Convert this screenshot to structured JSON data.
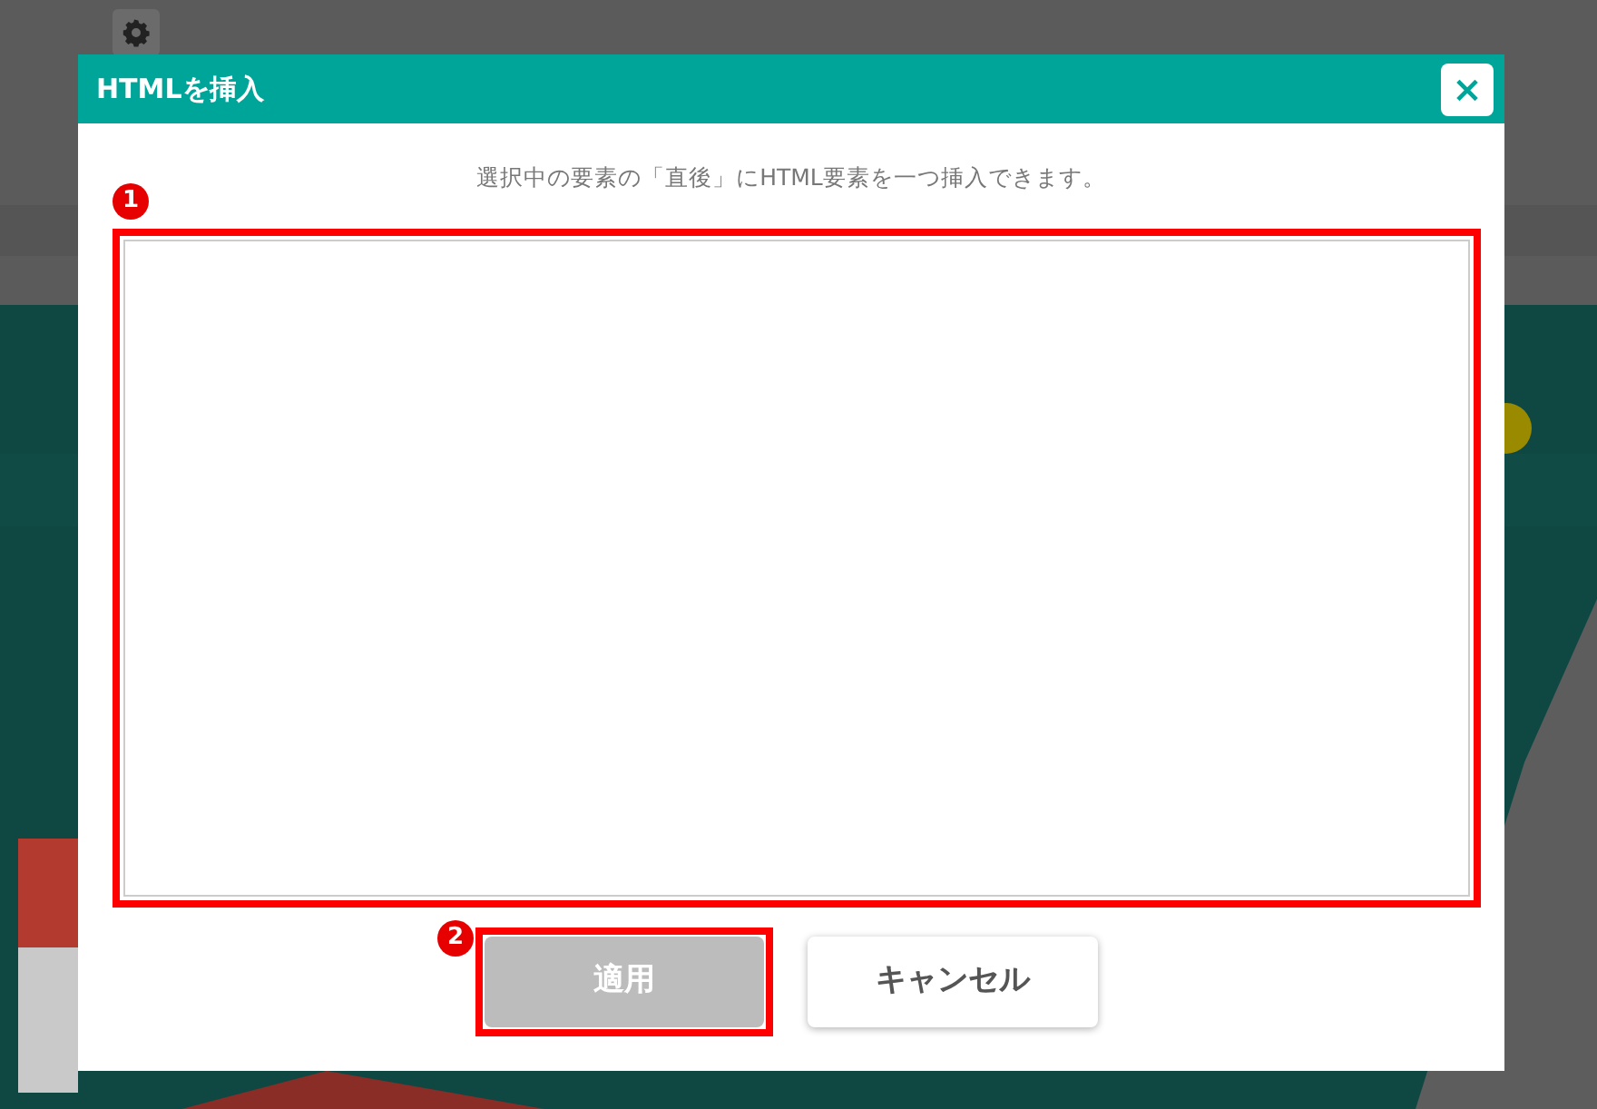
{
  "dialog": {
    "title": "HTMLを挿入",
    "close_label": "×",
    "description": "選択中の要素の「直後」にHTML要素を一つ挿入できます。",
    "editor": {
      "highlighted": true,
      "marker": "1"
    },
    "buttons": [
      {
        "label": "適用",
        "kind": "primary",
        "disabled": true,
        "highlighted": true,
        "marker": "2"
      },
      {
        "label": "キャンセル",
        "kind": "secondary",
        "disabled": false,
        "highlighted": false
      }
    ]
  }
}
